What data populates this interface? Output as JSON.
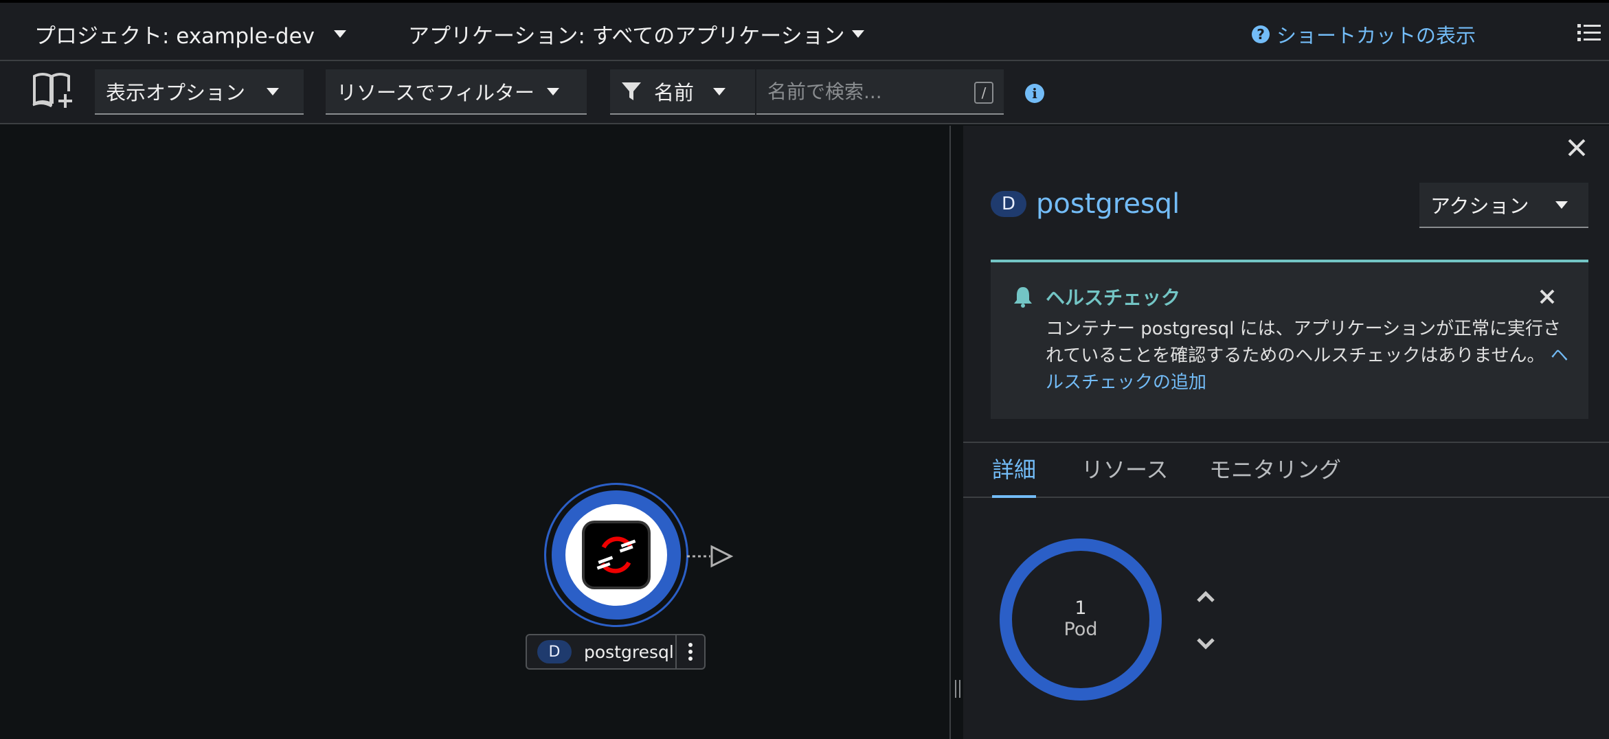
{
  "topbar": {
    "project_label": "プロジェクト: example-dev",
    "application_label": "アプリケーション: すべてのアプリケーション",
    "shortcuts_label": "ショートカットの表示"
  },
  "toolbar": {
    "display_options_label": "表示オプション",
    "resource_filter_label": "リソースでフィルター",
    "name_filter_label": "名前",
    "search_placeholder": "名前で検索...",
    "search_shortcut_key": "/"
  },
  "topology": {
    "node_badge": "D",
    "node_name": "postgresql"
  },
  "side_panel": {
    "badge": "D",
    "title": "postgresql",
    "action_label": "アクション",
    "alert": {
      "title": "ヘルスチェック",
      "message": "コンテナー postgresql には、アプリケーションが正常に実行されていることを確認するためのヘルスチェックはありません。",
      "link_text": "ヘルスチェックの追加"
    },
    "tabs": [
      {
        "label": "詳細"
      },
      {
        "label": "リソース"
      },
      {
        "label": "モニタリング"
      }
    ],
    "pod": {
      "count": "1",
      "label": "Pod"
    }
  },
  "colors": {
    "accent_blue": "#73bcf7",
    "node_blue": "#2b5fc7",
    "alert_teal": "#73c5c5"
  }
}
